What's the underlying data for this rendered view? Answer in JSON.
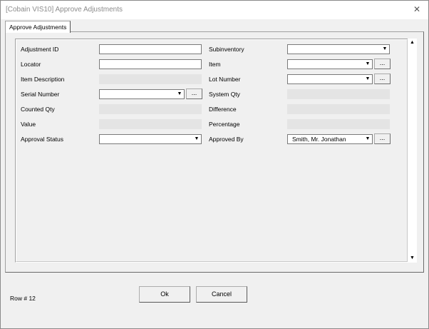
{
  "window": {
    "title": "[Cobain VIS10] Approve Adjustments",
    "close_label": "✕"
  },
  "tabs": [
    {
      "label": "Approve Adjustments",
      "active": true
    }
  ],
  "form": {
    "left": {
      "adjustment_id": {
        "label": "Adjustment ID",
        "value": ""
      },
      "locator": {
        "label": "Locator",
        "value": ""
      },
      "item_description": {
        "label": "Item Description",
        "value": ""
      },
      "serial_number": {
        "label": "Serial Number",
        "value": ""
      },
      "counted_qty": {
        "label": "Counted Qty",
        "value": ""
      },
      "value": {
        "label": "Value",
        "value": ""
      },
      "approval_status": {
        "label": "Approval Status",
        "value": ""
      }
    },
    "right": {
      "subinventory": {
        "label": "Subinventory",
        "value": ""
      },
      "item": {
        "label": "Item",
        "value": ""
      },
      "lot_number": {
        "label": "Lot Number",
        "value": ""
      },
      "system_qty": {
        "label": "System Qty",
        "value": ""
      },
      "difference": {
        "label": "Difference",
        "value": ""
      },
      "percentage": {
        "label": "Percentage",
        "value": ""
      },
      "approved_by": {
        "label": "Approved By",
        "value": "Smith, Mr. Jonathan"
      }
    },
    "lookup_button_label": "...",
    "dropdown_glyph": "▼"
  },
  "scrollbar": {
    "up_glyph": "▲",
    "down_glyph": "▼"
  },
  "footer": {
    "row_status": "Row # 12",
    "ok_label": "Ok",
    "cancel_label": "Cancel"
  },
  "colors": {
    "window_bg": "#f0f0f0",
    "readonly_field": "#e4e4e4",
    "title_text": "#8c8c8c"
  }
}
